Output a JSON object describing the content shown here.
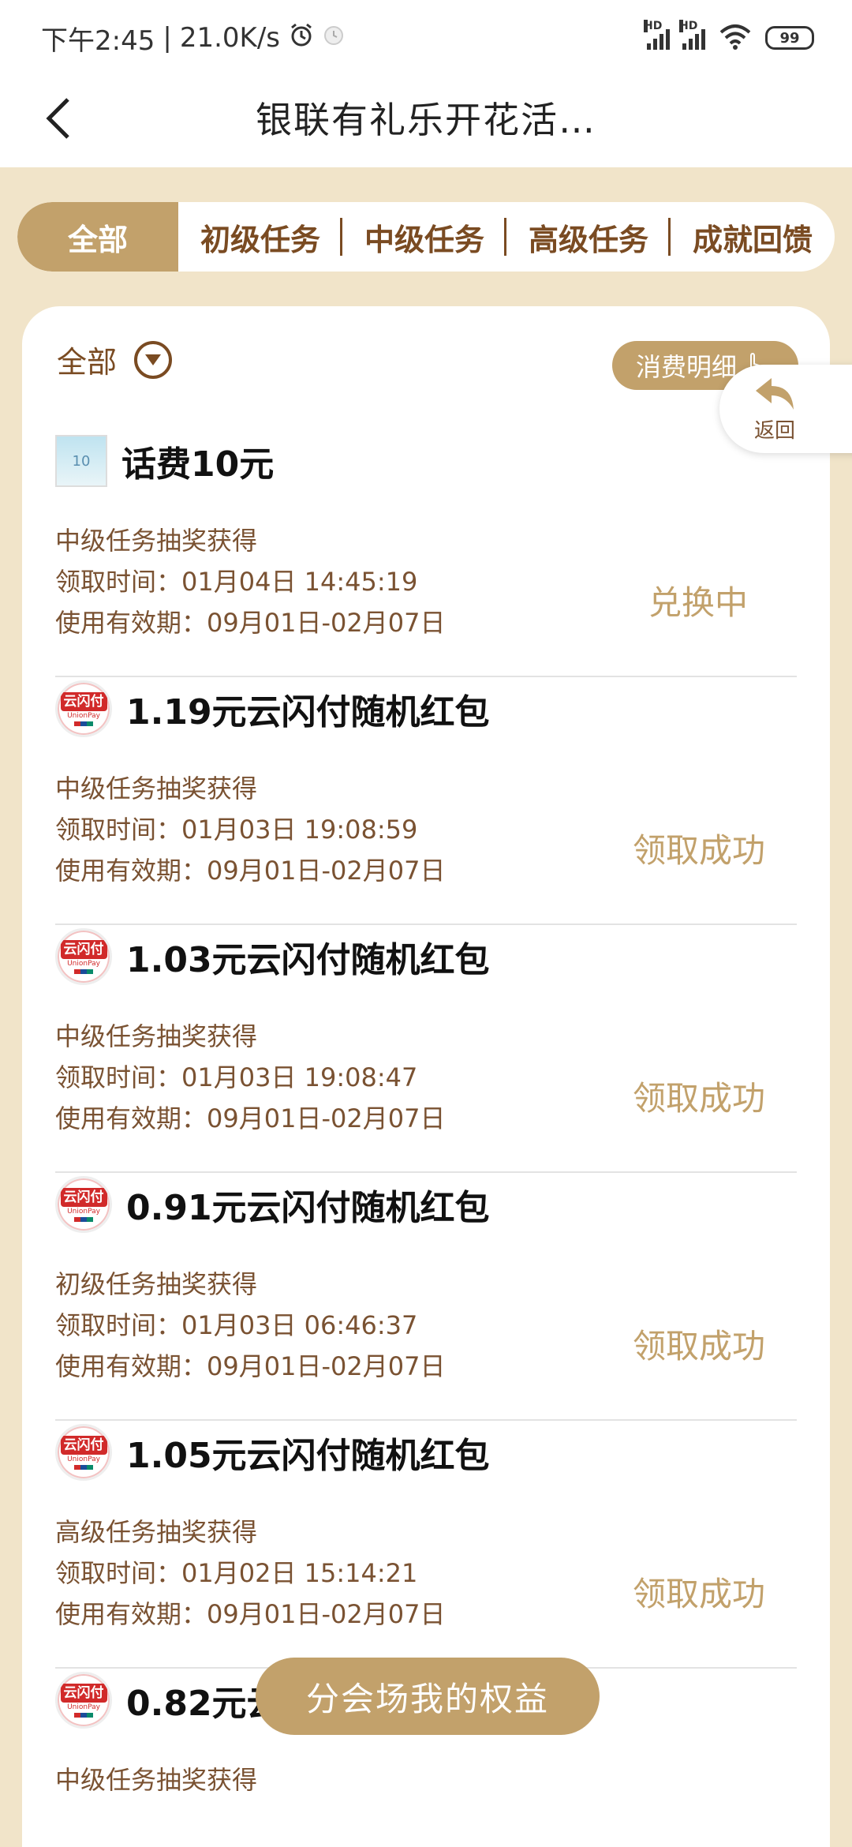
{
  "status_bar": {
    "time": "下午2:45",
    "speed": "21.0K/s",
    "sig1_label": "HD",
    "sig2_label": "HD",
    "battery": "99"
  },
  "header": {
    "title": "银联有礼乐开花活…"
  },
  "tabs": [
    {
      "label": "全部"
    },
    {
      "label": "初级任务"
    },
    {
      "label": "中级任务"
    },
    {
      "label": "高级任务"
    },
    {
      "label": "成就回馈"
    }
  ],
  "filter": {
    "label": "全部",
    "detail_button": "消费明细"
  },
  "float_back": {
    "label": "返回"
  },
  "items": [
    {
      "name": "话费10元",
      "source": "中级任务抽奖获得",
      "claim_label": "领取时间：",
      "claim_time": "01月04日 14:45:19",
      "valid_label": "使用有效期：",
      "valid": "09月01日-02月07日",
      "status": "兑换中",
      "icon": "phone-credit-thumb"
    },
    {
      "name": "1.19元云闪付随机红包",
      "source": "中级任务抽奖获得",
      "claim_label": "领取时间：",
      "claim_time": "01月03日 19:08:59",
      "valid_label": "使用有效期：",
      "valid": "09月01日-02月07日",
      "status": "领取成功",
      "icon": "unionpay-logo"
    },
    {
      "name": "1.03元云闪付随机红包",
      "source": "中级任务抽奖获得",
      "claim_label": "领取时间：",
      "claim_time": "01月03日 19:08:47",
      "valid_label": "使用有效期：",
      "valid": "09月01日-02月07日",
      "status": "领取成功",
      "icon": "unionpay-logo"
    },
    {
      "name": "0.91元云闪付随机红包",
      "source": "初级任务抽奖获得",
      "claim_label": "领取时间：",
      "claim_time": "01月03日 06:46:37",
      "valid_label": "使用有效期：",
      "valid": "09月01日-02月07日",
      "status": "领取成功",
      "icon": "unionpay-logo"
    },
    {
      "name": "1.05元云闪付随机红包",
      "source": "高级任务抽奖获得",
      "claim_label": "领取时间：",
      "claim_time": "01月02日 15:14:21",
      "valid_label": "使用有效期：",
      "valid": "09月01日-02月07日",
      "status": "领取成功",
      "icon": "unionpay-logo"
    },
    {
      "name": "0.82元云",
      "source": "中级任务抽奖获得",
      "icon": "unionpay-logo"
    }
  ],
  "logo_text": {
    "main": "云闪付",
    "sub": "UnionPay"
  },
  "bottom_button": {
    "label": "分会场我的权益"
  },
  "colors": {
    "accent": "#c2a16b",
    "brown": "#7a4b22",
    "background": "#f1e4c9"
  }
}
